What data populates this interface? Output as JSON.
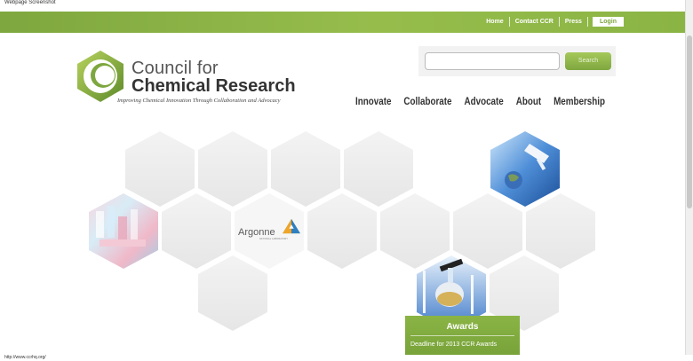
{
  "window": {
    "caption": "Webpage Screenshot"
  },
  "topnav": {
    "items": [
      "Home",
      "Contact CCR",
      "Press"
    ],
    "login": "Login"
  },
  "search": {
    "placeholder": "",
    "button_label": "Search"
  },
  "logo": {
    "line1": "Council for",
    "line2": "Chemical Research",
    "tagline": "Improving Chemical Innovation Through Collaboration and Advocacy"
  },
  "mainnav": [
    "Innovate",
    "Collaborate",
    "Advocate",
    "About",
    "Membership"
  ],
  "partner_logo": {
    "name": "Argonne",
    "subtitle": "NATIONAL LABORATORY"
  },
  "awards": {
    "title": "Awards",
    "text": "Deadline for 2013 CCR Awards"
  },
  "status": {
    "url": "http://www.ccrhq.org/"
  },
  "colors": {
    "brand_green": "#7ea73f",
    "light_green": "#a6c85a",
    "hex_gray": "#ececec"
  }
}
